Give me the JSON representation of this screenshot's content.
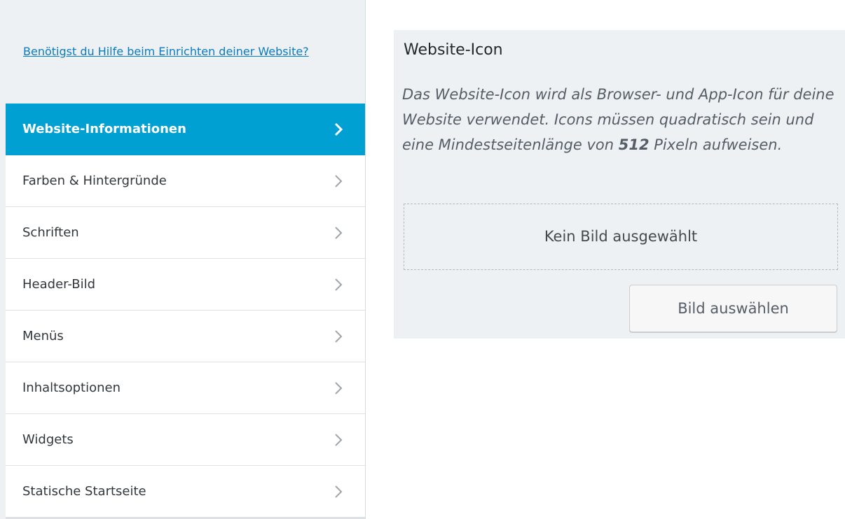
{
  "help": {
    "link_text": "Benötigst du Hilfe beim Einrichten deiner Website?"
  },
  "menu": {
    "items": [
      {
        "label": "Website-Informationen",
        "active": true
      },
      {
        "label": "Farben & Hintergründe",
        "active": false
      },
      {
        "label": "Schriften",
        "active": false
      },
      {
        "label": "Header-Bild",
        "active": false
      },
      {
        "label": "Menüs",
        "active": false
      },
      {
        "label": "Inhaltsoptionen",
        "active": false
      },
      {
        "label": "Widgets",
        "active": false
      },
      {
        "label": "Statische Startseite",
        "active": false
      }
    ],
    "chevron_icon": "chevron-right-icon"
  },
  "site_icon": {
    "title": "Website-Icon",
    "description_before": "Das Website-Icon wird als Browser- und App-Icon für deine Website verwendet. Icons müssen quadratisch sein und eine Mindestseitenlänge von ",
    "description_number": "512",
    "description_after": " Pixeln aufweisen.",
    "placeholder": "Kein Bild ausgewählt",
    "select_button": "Bild auswählen"
  },
  "colors": {
    "accent": "#00a0d2",
    "link": "#0a7bbf",
    "panel_background": "#eef1f4"
  }
}
